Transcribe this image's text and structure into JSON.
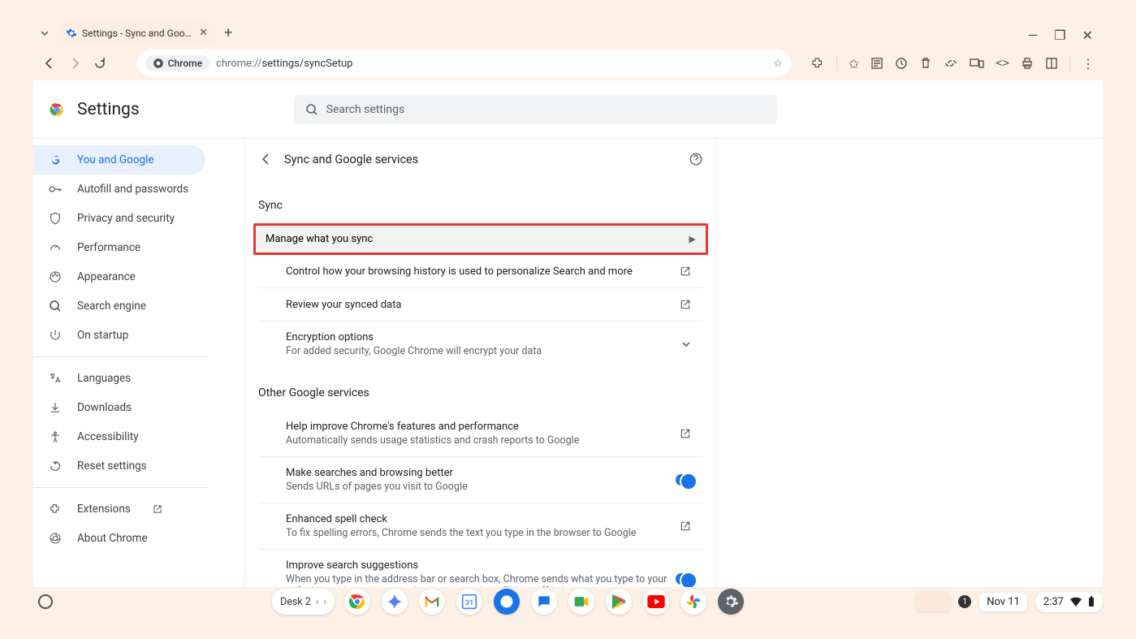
{
  "browser": {
    "tab_title": "Settings - Sync and Google services",
    "url_prefix": "chrome://",
    "url_path": "settings/syncSetup",
    "chrome_chip": "Chrome"
  },
  "header": {
    "title": "Settings",
    "search_placeholder": "Search settings"
  },
  "sidebar": {
    "items": [
      {
        "label": "You and Google"
      },
      {
        "label": "Autofill and passwords"
      },
      {
        "label": "Privacy and security"
      },
      {
        "label": "Performance"
      },
      {
        "label": "Appearance"
      },
      {
        "label": "Search engine"
      },
      {
        "label": "On startup"
      }
    ],
    "items2": [
      {
        "label": "Languages"
      },
      {
        "label": "Downloads"
      },
      {
        "label": "Accessibility"
      },
      {
        "label": "Reset settings"
      }
    ],
    "items3": [
      {
        "label": "Extensions"
      },
      {
        "label": "About Chrome"
      }
    ]
  },
  "page": {
    "title": "Sync and Google services",
    "sync_label": "Sync",
    "manage": "Manage what you sync",
    "control": "Control how your browsing history is used to personalize Search and more",
    "review": "Review your synced data",
    "encryption_title": "Encryption options",
    "encryption_sub": "For added security, Google Chrome will encrypt your data",
    "other_label": "Other Google services",
    "improve_title": "Help improve Chrome's features and performance",
    "improve_sub": "Automatically sends usage statistics and crash reports to Google",
    "make_title": "Make searches and browsing better",
    "make_sub": "Sends URLs of pages you visit to Google",
    "spell_title": "Enhanced spell check",
    "spell_sub": "To fix spelling errors, Chrome sends the text you type in the browser to Google",
    "suggest_title": "Improve search suggestions",
    "suggest_sub": "When you type in the address bar or search box, Chrome sends what you type to your default search engine to get better suggestions. This is off in Incognito."
  },
  "taskbar": {
    "desk": "Desk 2",
    "date": "Nov 11",
    "time": "2:37",
    "notif_count": "1"
  }
}
